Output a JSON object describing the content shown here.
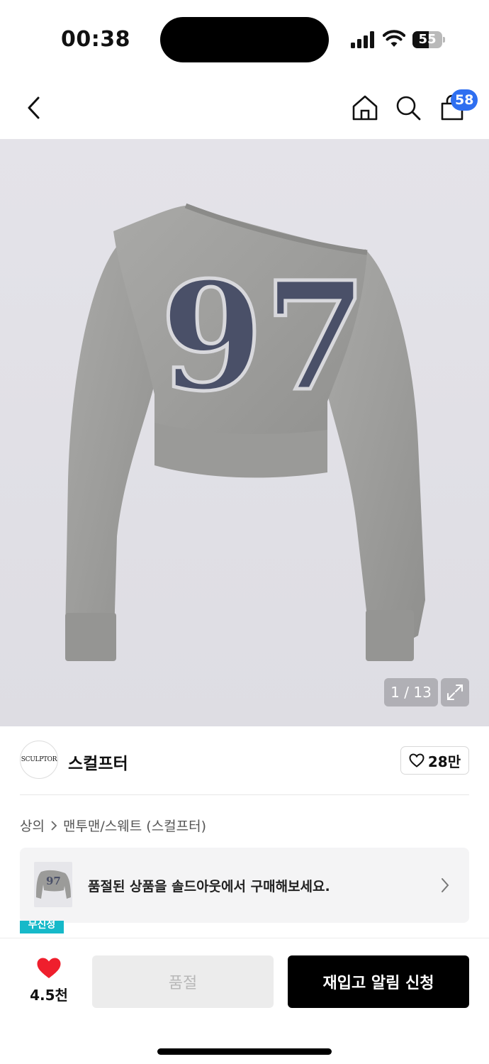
{
  "status_bar": {
    "time": "00:38",
    "battery": "55",
    "battery_level_percent": 55
  },
  "top_nav": {
    "back_icon": "chevron-left-icon",
    "home_icon": "home-icon",
    "search_icon": "search-icon",
    "cart_icon": "shopping-bag-icon",
    "cart_count": "58"
  },
  "product_image": {
    "print_text": "97",
    "counter": "1 / 13",
    "expand_icon": "expand-icon"
  },
  "brand": {
    "logo_text": "SCULPTOR",
    "name": "스컬프터",
    "likes": "28만"
  },
  "breadcrumb": {
    "items": [
      "상의",
      "맨투맨/스웨트 (스컬프터)"
    ]
  },
  "banner": {
    "text": "품절된 상품을 솔드아웃에서 구매해보세요.",
    "badge": "무신정"
  },
  "bottom_bar": {
    "wish_count": "4.5천",
    "soldout_label": "품절",
    "restock_label": "재입고 알림 신청"
  },
  "colors": {
    "accent_blue": "#2f6ff0",
    "heart_red": "#ef1f2d",
    "badge_teal": "#16b9c9",
    "cta_black": "#000000",
    "print_navy": "#4a5068"
  }
}
